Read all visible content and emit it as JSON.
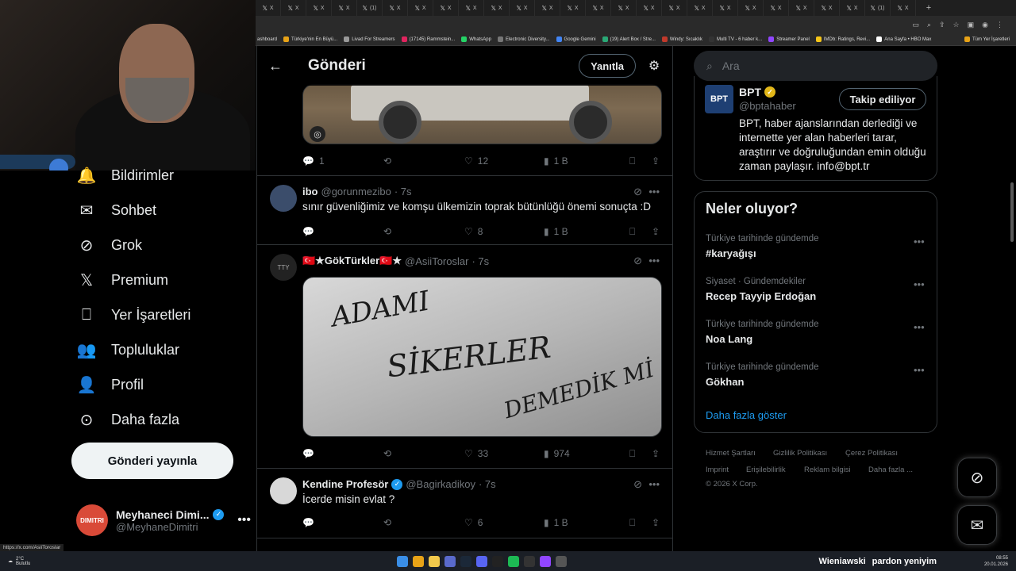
{
  "browser": {
    "tabs": [
      "X",
      "X",
      "X",
      "X",
      "(1)",
      "X",
      "X",
      "X",
      "X",
      "X",
      "X",
      "X",
      "X",
      "X",
      "X",
      "X",
      "X",
      "X",
      "X",
      "X",
      "X",
      "X",
      "X",
      "X",
      "(1)",
      "X"
    ],
    "bookmarks": [
      "ashboard",
      "Türkiye'nin En Büyü...",
      "Livad For Streamers",
      "(17145) Rammstein...",
      "WhatsApp",
      "Electronic Diversity...",
      "Google Gemini",
      "(19) Alert Box / Stre...",
      "Windy: Sıcaklık",
      "Multi TV - 6 haber k...",
      "Streamer Panel",
      "IMDb: Ratings, Revi...",
      "Ana Sayfa • HBO Max"
    ],
    "bookmarks_all": "Tüm Yer İşaretleri",
    "status_url": "https://x.com/AsiiToroslar"
  },
  "nav": {
    "items": [
      {
        "label": "Bildirimler",
        "icon": "bell-icon"
      },
      {
        "label": "Sohbet",
        "icon": "mail-icon"
      },
      {
        "label": "Grok",
        "icon": "grok-icon"
      },
      {
        "label": "Premium",
        "icon": "x-logo-icon"
      },
      {
        "label": "Yer İşaretleri",
        "icon": "bookmark-icon"
      },
      {
        "label": "Topluluklar",
        "icon": "people-icon"
      },
      {
        "label": "Profil",
        "icon": "person-icon"
      },
      {
        "label": "Daha fazla",
        "icon": "more-circle-icon"
      }
    ],
    "post_button": "Gönderi yayınla",
    "account": {
      "name": "Meyhaneci Dimi...",
      "handle": "@MeyhaneDimitri",
      "avatar_text": "DIMITRI"
    }
  },
  "header": {
    "title": "Gönderi",
    "reply_button": "Yanıtla"
  },
  "first_post_actions": {
    "replies": "1",
    "reposts": "",
    "likes": "12",
    "views": "1 B"
  },
  "replies": [
    {
      "name": "ibo",
      "handle": "@gorunmezibo",
      "time": "· 7s",
      "text": "sınır güvenliğimiz ve komşu ülkemizin toprak bütünlüğü önemi sonuçta :D",
      "replies": "",
      "likes": "8",
      "views": "1 B"
    },
    {
      "name": "🇹🇷★GökTürkler🇹🇷★",
      "handle": "@AsiiToroslar",
      "time": "· 7s",
      "text": "",
      "replies": "",
      "likes": "33",
      "views": "974",
      "image_text": [
        "ADAMI",
        "SİKERLER",
        "DEMEDİK Mİ"
      ]
    },
    {
      "name": "Kendine Profesör",
      "handle": "@Bagirkadikoy",
      "time": "· 7s",
      "text": "İcerde misin evlat ?",
      "replies": "",
      "likes": "6",
      "views": "1 B",
      "verified": true
    }
  ],
  "right": {
    "search_placeholder": "Ara",
    "bpt": {
      "name": "BPT",
      "handle": "@bptahaber",
      "avatar": "BPT",
      "follow": "Takip ediliyor",
      "bio": "BPT, haber ajanslarından derlediği ve internette yer alan haberleri tarar, araştırır ve doğruluğundan emin olduğu zaman paylaşır. info@bpt.tr"
    },
    "trends_title": "Neler oluyor?",
    "trends": [
      {
        "context": "Türkiye tarihinde gündemde",
        "name": "#karyağışı"
      },
      {
        "context": "Siyaset · Gündemdekiler",
        "name": "Recep Tayyip Erdoğan"
      },
      {
        "context": "Türkiye tarihinde gündemde",
        "name": "Noa Lang"
      },
      {
        "context": "Türkiye tarihinde gündemde",
        "name": "Gökhan"
      }
    ],
    "show_more": "Daha fazla göster",
    "footer": [
      "Hizmet Şartları",
      "Gizlilik Politikası",
      "Çerez Politikası",
      "Imprint",
      "Erişilebilirlik",
      "Reklam bilgisi",
      "Daha fazla ...",
      "© 2026 X Corp."
    ]
  },
  "taskbar": {
    "weather_temp": "2°C",
    "weather_desc": "Bulutlu",
    "now_playing_artist": "Wieniawski",
    "now_playing_title": "pardon yeniyim",
    "time": "08:55",
    "date": "20.01.2026"
  },
  "colors": {
    "accent": "#1d9bf0",
    "background": "#000000",
    "border": "#2f3336",
    "muted": "#71767b"
  }
}
